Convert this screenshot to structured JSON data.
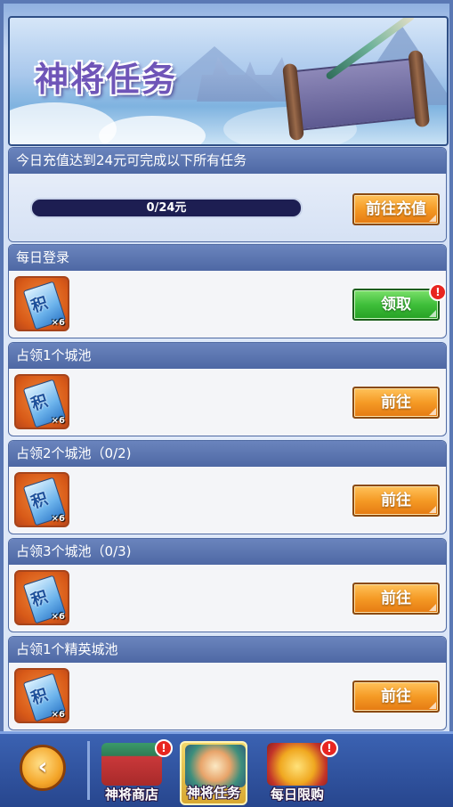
{
  "banner": {
    "title": "神将任务"
  },
  "recharge": {
    "header": "今日充值达到24元可完成以下所有任务",
    "progress_text": "0/24元",
    "progress_fraction": 0,
    "button_label": "前往充值"
  },
  "tasks": [
    {
      "title": "每日登录",
      "reward_glyph": "积",
      "reward_count": "×6",
      "button_label": "领取",
      "button_style": "green",
      "has_alert": true,
      "alert_mark": "!"
    },
    {
      "title": "占领1个城池",
      "reward_glyph": "积",
      "reward_count": "×6",
      "button_label": "前往",
      "button_style": "orange",
      "has_alert": false
    },
    {
      "title": "占领2个城池（0/2)",
      "reward_glyph": "积",
      "reward_count": "×6",
      "button_label": "前往",
      "button_style": "orange",
      "has_alert": false
    },
    {
      "title": "占领3个城池（0/3)",
      "reward_glyph": "积",
      "reward_count": "×6",
      "button_label": "前往",
      "button_style": "orange",
      "has_alert": false
    },
    {
      "title": "占领1个精英城池",
      "reward_glyph": "积",
      "reward_count": "×6",
      "button_label": "前往",
      "button_style": "orange",
      "has_alert": false
    }
  ],
  "bottom_bar": {
    "back_icon": "back-arrow-icon",
    "back_glyph": "‹",
    "tabs": [
      {
        "label": "神将商店",
        "active": false,
        "alert_mark": "!"
      },
      {
        "label": "神将任务",
        "active": true
      },
      {
        "label": "每日限购",
        "active": false,
        "alert_mark": "!"
      }
    ]
  },
  "colors": {
    "header_blue": "#4e68a4",
    "button_orange": "#f59a25",
    "button_green": "#3fbf3a",
    "progress_track": "#1d1e52",
    "alert_red": "#e82620"
  }
}
